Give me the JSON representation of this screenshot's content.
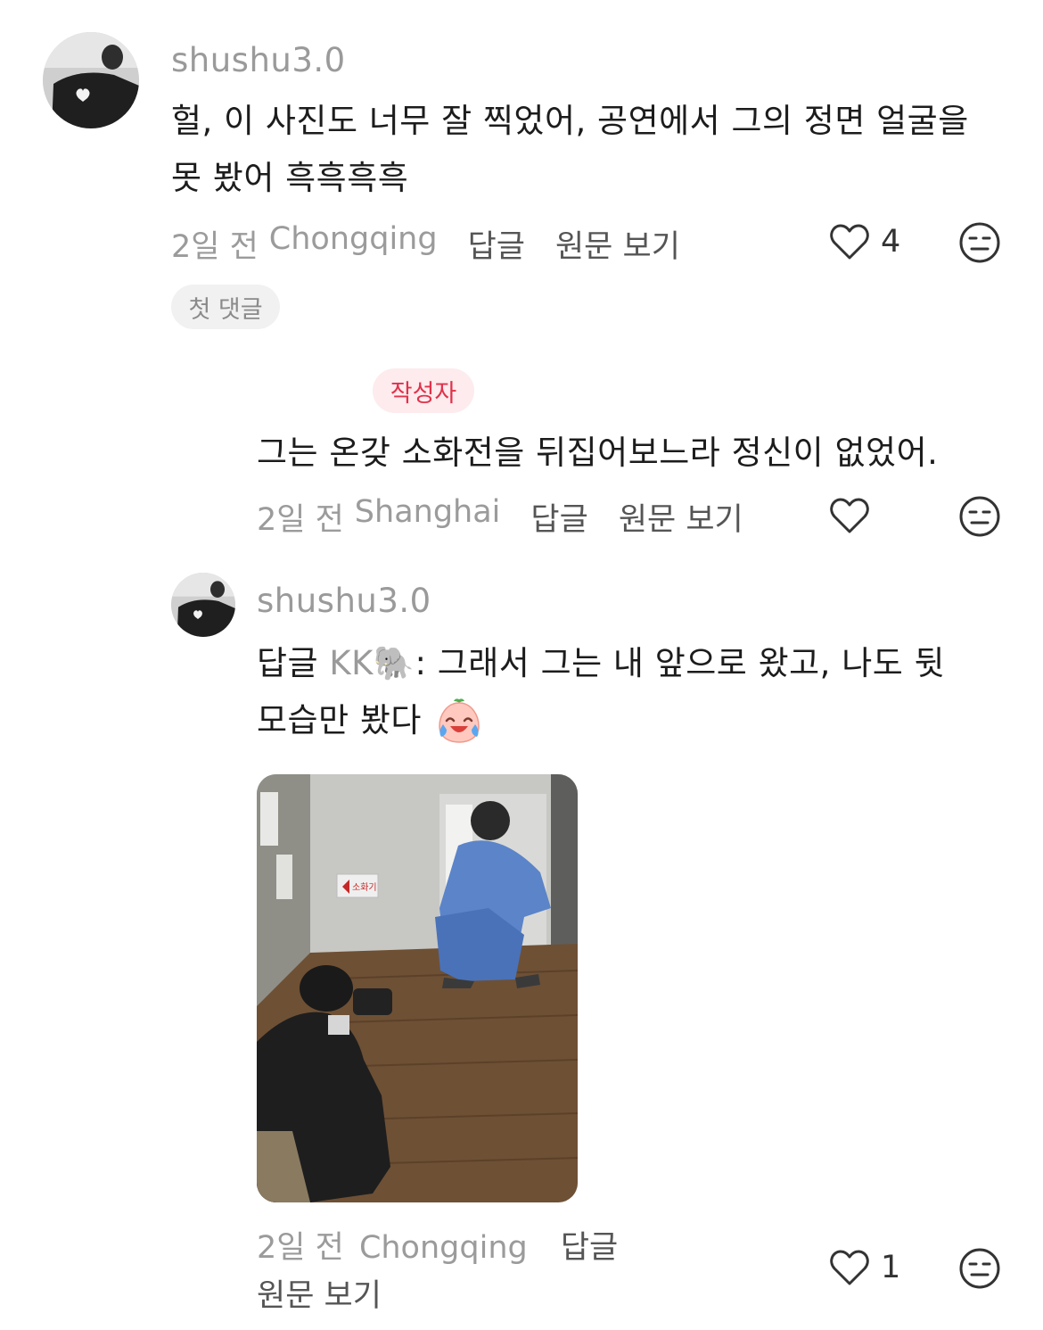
{
  "comments": [
    {
      "username": "shushu3.0",
      "text_line1": "헐, 이 사진도 너무 잘 찍었어, 공연에서 그의 정면 얼굴을",
      "text_line2": "못 봤어 흑흑흑흑",
      "time": "2일 전",
      "location": "Chongqing",
      "reply_label": "답글",
      "view_original_label": "원문 보기",
      "likes": "4",
      "badge": "첫 댓글"
    },
    {
      "author_badge": "작성자",
      "text_line1": "그는 온갖 소화전을 뒤집어보느라 정신이 없었어.",
      "time": "2일 전",
      "location": "Shanghai",
      "reply_label": "답글",
      "view_original_label": "원문 보기"
    },
    {
      "username": "shushu3.0",
      "reply_prefix": "답글",
      "reply_to": "KK🐘",
      "text_line1_rest": ": 그래서 그는 내 앞으로 왔고, 나도 뒷",
      "text_line2": "모습만 봤다",
      "time": "2일 전",
      "location": "Chongqing",
      "reply_label": "답글",
      "view_original_label": "원문 보기",
      "likes": "1",
      "photo_sign_text": "소화기"
    }
  ],
  "colors": {
    "meta_grey": "#9b9b9b",
    "author_red": "#e0324b",
    "author_bg": "#fdebed"
  },
  "icons": [
    "heart-outline-icon",
    "neutral-face-icon",
    "crying-laughing-emoji"
  ]
}
